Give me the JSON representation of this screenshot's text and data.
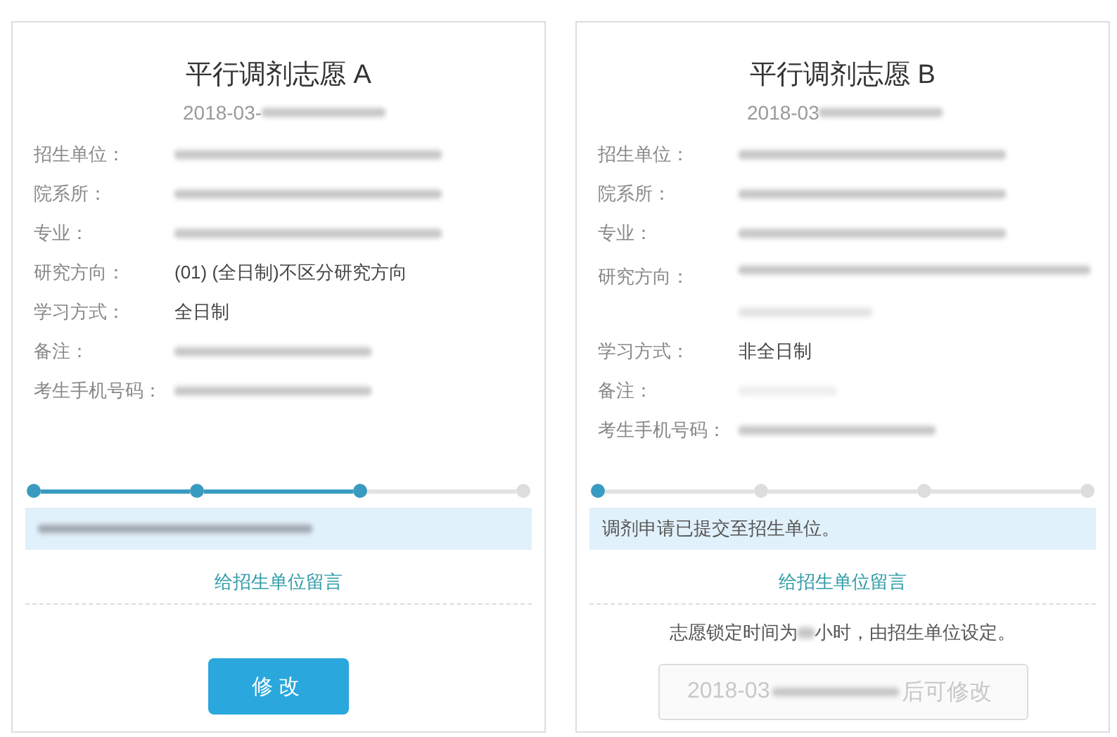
{
  "cards": [
    {
      "title": "平行调剂志愿 A",
      "date_prefix": "2018-03-",
      "fields": [
        {
          "label": "招生单位：",
          "kind": "redacted"
        },
        {
          "label": "院系所：",
          "kind": "redacted"
        },
        {
          "label": "专业：",
          "kind": "redacted"
        },
        {
          "label": "研究方向：",
          "kind": "text",
          "value": "(01) (全日制)不区分研究方向"
        },
        {
          "label": "学习方式：",
          "kind": "text",
          "value": "全日制"
        },
        {
          "label": "备注：",
          "kind": "redacted_short"
        },
        {
          "label": "考生手机号码：",
          "kind": "redacted_short"
        }
      ],
      "steps": [
        {
          "done": true
        },
        {
          "done": true
        },
        {
          "done": true
        },
        {
          "done": false
        }
      ],
      "notice": {
        "kind": "redacted"
      },
      "link": "给招生单位留言",
      "footer": {
        "kind": "button",
        "label": "修改"
      }
    },
    {
      "title": "平行调剂志愿 B",
      "date_prefix": "2018-03",
      "fields": [
        {
          "label": "招生单位：",
          "kind": "redacted"
        },
        {
          "label": "院系所：",
          "kind": "redacted"
        },
        {
          "label": "专业：",
          "kind": "redacted"
        },
        {
          "label": "研究方向：",
          "kind": "redacted_long"
        },
        {
          "label": "学习方式：",
          "kind": "text",
          "value": "非全日制"
        },
        {
          "label": "备注：",
          "kind": "redacted_faint"
        },
        {
          "label": "考生手机号码：",
          "kind": "redacted_short"
        }
      ],
      "steps": [
        {
          "done": true
        },
        {
          "done": false
        },
        {
          "done": false
        },
        {
          "done": false
        }
      ],
      "notice": {
        "kind": "text",
        "text": "调剂申请已提交至招生单位。"
      },
      "link": "给招生单位留言",
      "footer": {
        "kind": "locked",
        "note_before": "志愿锁定时间为",
        "note_after": "小时，由招生单位设定。",
        "button_prefix": "2018-03",
        "button_suffix": "后可修改"
      }
    }
  ]
}
